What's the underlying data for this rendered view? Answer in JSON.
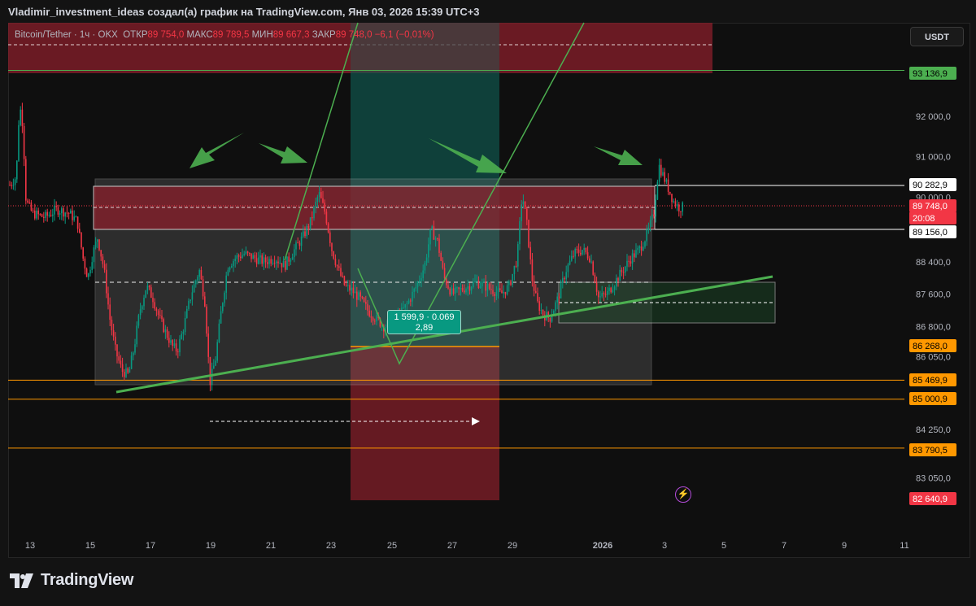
{
  "header": {
    "title": "Vladimir_investment_ideas создал(а) график на TradingView.com, Янв 03, 2026 15:39 UTC+3"
  },
  "symbol_bar": {
    "symbol": "Bitcoin/Tether · 1ч · OKX",
    "open_label": "ОТКР",
    "open_value": "89 754,0",
    "high_label": "МАКС",
    "high_value": "89 789,5",
    "low_label": "МИН",
    "low_value": "89 667,3",
    "close_label": "ЗАКР",
    "close_value": "89 748,0",
    "change": "−6,1 (−0,01%)"
  },
  "currency_button": "USDT",
  "measure_tooltip": {
    "line1": "1 599,9 · 0.069",
    "line2": "2,89"
  },
  "brand": {
    "name": "TradingView"
  },
  "colors": {
    "up": "#089981",
    "down": "#f23645",
    "trendline": "#4caf50",
    "level_orange": "#ff9800",
    "level_green": "#4caf50",
    "level_red": "#f23645",
    "zone_red": "#8a1f2b",
    "zone_grey": "#6b6b6b"
  },
  "chart_data": {
    "type": "candlestick",
    "symbol": "Bitcoin/Tether",
    "timeframe": "1ч",
    "exchange": "OKX",
    "x_ticks": [
      "13",
      "15",
      "17",
      "19",
      "21",
      "23",
      "25",
      "27",
      "29",
      "2026",
      "3",
      "5",
      "7",
      "9",
      "11"
    ],
    "y_ticks": [
      {
        "label": "92 000,0",
        "value": 92000
      },
      {
        "label": "91 000,0",
        "value": 91000
      },
      {
        "label": "90 000,0",
        "value": 90000
      },
      {
        "label": "88 400,0",
        "value": 88400
      },
      {
        "label": "87 600,0",
        "value": 87600
      },
      {
        "label": "86 800,0",
        "value": 86800
      },
      {
        "label": "86 050,0",
        "value": 86050
      },
      {
        "label": "84 250,0",
        "value": 84250
      },
      {
        "label": "83 050,0",
        "value": 83050
      }
    ],
    "price_labels": [
      {
        "label": "93 136,9",
        "value": 93136.9,
        "color": "#4caf50",
        "text_color": "#000000"
      },
      {
        "label": "90 282,9",
        "value": 90282.9,
        "color": "#ffffff",
        "text_color": "#000000"
      },
      {
        "label": "89 748,0",
        "value": 89748.0,
        "color": "#f23645",
        "text_color": "#ffffff"
      },
      {
        "label": "20:08",
        "value": 89620,
        "color": "#f23645",
        "text_color": "#ffffff"
      },
      {
        "label": "89 156,0",
        "value": 89156.0,
        "color": "#ffffff",
        "text_color": "#000000"
      },
      {
        "label": "86 268,0",
        "value": 86268.0,
        "color": "#ff9800",
        "text_color": "#000000"
      },
      {
        "label": "85 469,9",
        "value": 85469.9,
        "color": "#ff9800",
        "text_color": "#000000"
      },
      {
        "label": "85 000,9",
        "value": 85000.9,
        "color": "#ff9800",
        "text_color": "#000000"
      },
      {
        "label": "83 790,5",
        "value": 83790.5,
        "color": "#ff9800",
        "text_color": "#000000"
      },
      {
        "label": "82 640,9",
        "value": 82640.9,
        "color": "#f23645",
        "text_color": "#ffffff"
      }
    ],
    "horizontal_levels": [
      {
        "value": 93136.9,
        "color": "#4caf50",
        "style": "solid"
      },
      {
        "value": 85469.9,
        "color": "#ff9800",
        "style": "solid"
      },
      {
        "value": 85000.9,
        "color": "#ff9800",
        "style": "solid"
      },
      {
        "value": 83790.5,
        "color": "#ff9800",
        "style": "solid"
      }
    ],
    "grid": false,
    "last_price": 89748.0
  }
}
